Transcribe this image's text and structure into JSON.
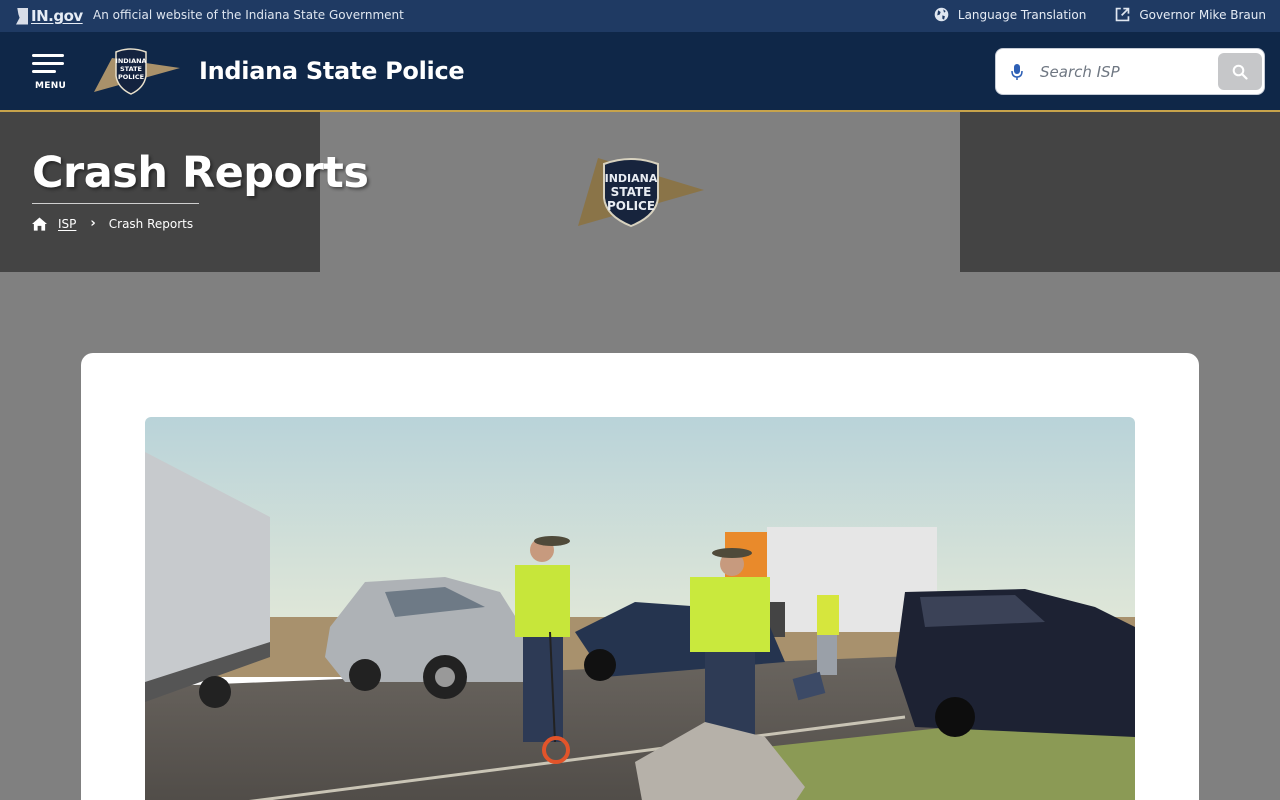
{
  "gov_bar": {
    "logo_text": "IN.gov",
    "official_text": "An official website of the Indiana State Government",
    "language_label": "Language Translation",
    "governor_label": "Governor Mike Braun"
  },
  "header": {
    "menu_label": "MENU",
    "logo_text": [
      "INDIANA",
      "STATE",
      "POLICE"
    ],
    "site_title": "Indiana State Police",
    "search": {
      "placeholder": "Search ISP",
      "value": ""
    }
  },
  "hero": {
    "title": "Crash Reports",
    "breadcrumb": {
      "home": "ISP",
      "current": "Crash Reports"
    },
    "logo_text": [
      "INDIANA",
      "STATE",
      "POLICE"
    ]
  },
  "colors": {
    "gov_bar": "#1f3a63",
    "header": "#0f2748",
    "accent_gold": "#c7a34b",
    "hero_gray": "#808080",
    "hero_dark": "#444444"
  },
  "icons": {
    "globe": "globe-icon",
    "external": "external-link-icon",
    "menu": "hamburger-icon",
    "mic": "microphone-icon",
    "search": "search-icon",
    "home": "home-icon",
    "chevron": "chevron-right-icon"
  }
}
